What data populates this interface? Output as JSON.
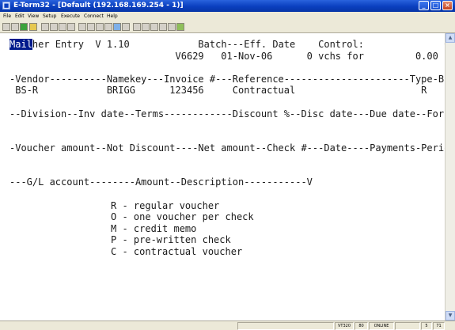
{
  "window": {
    "app_icon": "terminal-app-icon",
    "title": "E-Term32 - [Default (192.168.169.254 - 1)]",
    "buttons": {
      "minimize": "_",
      "maximize": "□",
      "close": "×"
    }
  },
  "menu": [
    "File",
    "Edit",
    "View",
    "Setup",
    "Execute",
    "Connect",
    "Help"
  ],
  "toolbar": {
    "icons": [
      "disconnect-icon",
      "print-icon",
      "connect-icon",
      "open-icon",
      "save-icon",
      "cut-icon",
      "copy-icon",
      "paste-icon",
      "session-icon",
      "keyboard-icon",
      "transfer-icon",
      "settings-icon",
      "monitor-icon",
      "macro-icon",
      "tools-icon",
      "find-icon",
      "script-icon",
      "capture-icon",
      "config-icon",
      "help-icon"
    ]
  },
  "terminal": {
    "cursor_text": "Mail",
    "line1_rest": "her Entry  V 1.10            Batch---Eff. Date    Control:              0.00",
    "line2": "                             V6629   01-Nov-06      0 vchs for         0.00",
    "line3": "-Vendor----------Namekey---Invoice #---Reference----------------------Type-Bank",
    "line4": " BS-R            BRIGG      123456     Contractual                      R",
    "line5": "--Division--Inv date--Terms------------Discount %--Disc date---Due date--Force",
    "line6": "-Voucher amount--Not Discount----Net amount--Check #---Date----Payments-Period",
    "line7": "---G/L account--------Amount--Description-----------V",
    "options": [
      "R - regular voucher",
      "O - one voucher per check",
      "M - credit memo",
      "P - pre-written check",
      "C - contractual voucher"
    ]
  },
  "scrollbar": {
    "up": "▲",
    "down": "▼"
  },
  "status": {
    "emulation": "VT320",
    "columns": "80",
    "connection": "ONLINE",
    "cursor_row": "5",
    "cursor_col": "71"
  }
}
